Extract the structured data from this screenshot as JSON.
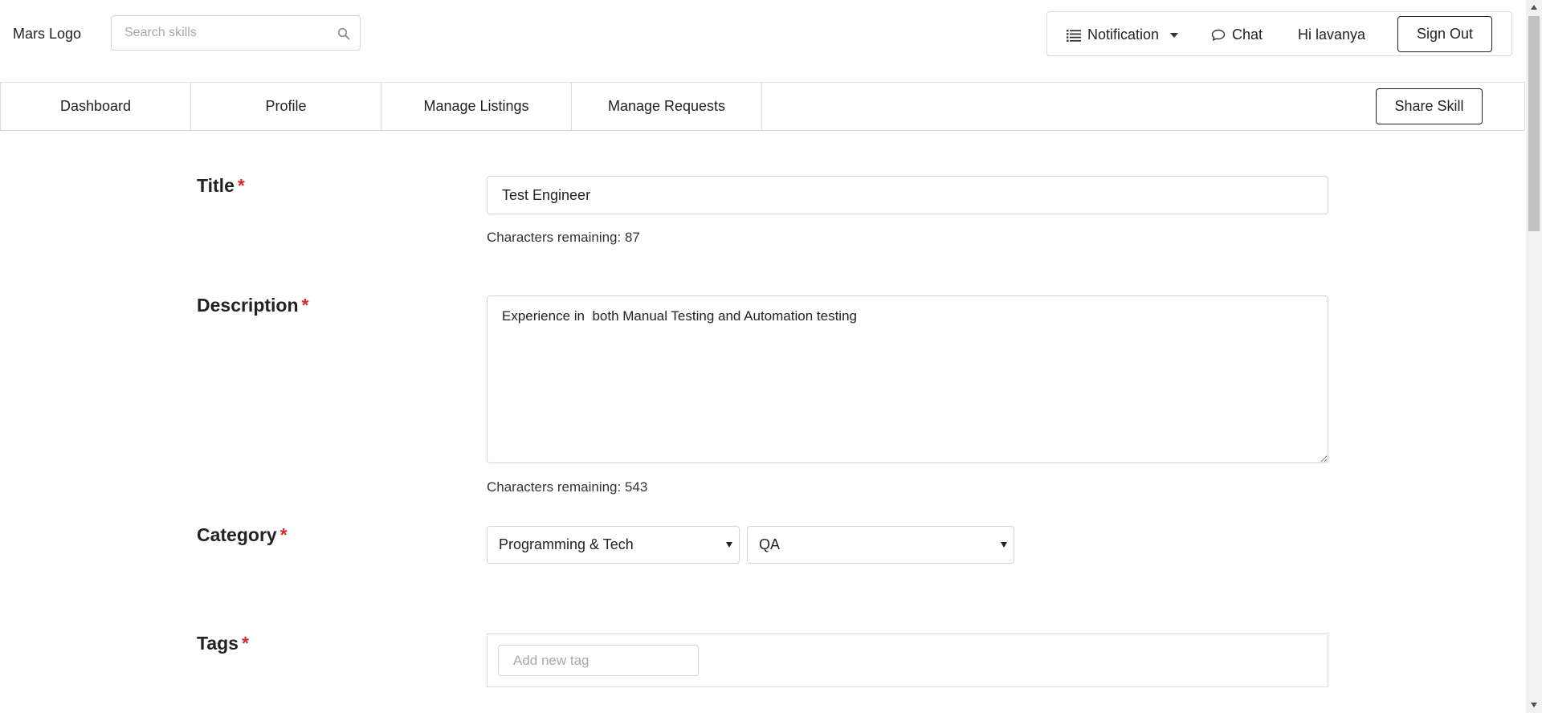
{
  "header": {
    "logo": "Mars Logo",
    "search_placeholder": "Search skills",
    "notification_label": "Notification",
    "chat_label": "Chat",
    "greeting": "Hi lavanya",
    "signout_label": "Sign Out"
  },
  "nav": {
    "tabs": [
      {
        "label": "Dashboard"
      },
      {
        "label": "Profile"
      },
      {
        "label": "Manage Listings"
      },
      {
        "label": "Manage Requests"
      }
    ],
    "share_label": "Share Skill"
  },
  "form": {
    "required_marker": "*",
    "title": {
      "label": "Title",
      "value": "Test Engineer",
      "chars_remaining": "Characters remaining: 87"
    },
    "description": {
      "label": "Description",
      "value": "Experience in  both Manual Testing and Automation testing",
      "chars_remaining": "Characters remaining: 543"
    },
    "category": {
      "label": "Category",
      "category_value": "Programming & Tech",
      "subcategory_value": "QA"
    },
    "tags": {
      "label": "Tags",
      "placeholder": "Add new tag"
    }
  },
  "colors": {
    "required": "#db2828",
    "border": "#d4d4d4"
  }
}
